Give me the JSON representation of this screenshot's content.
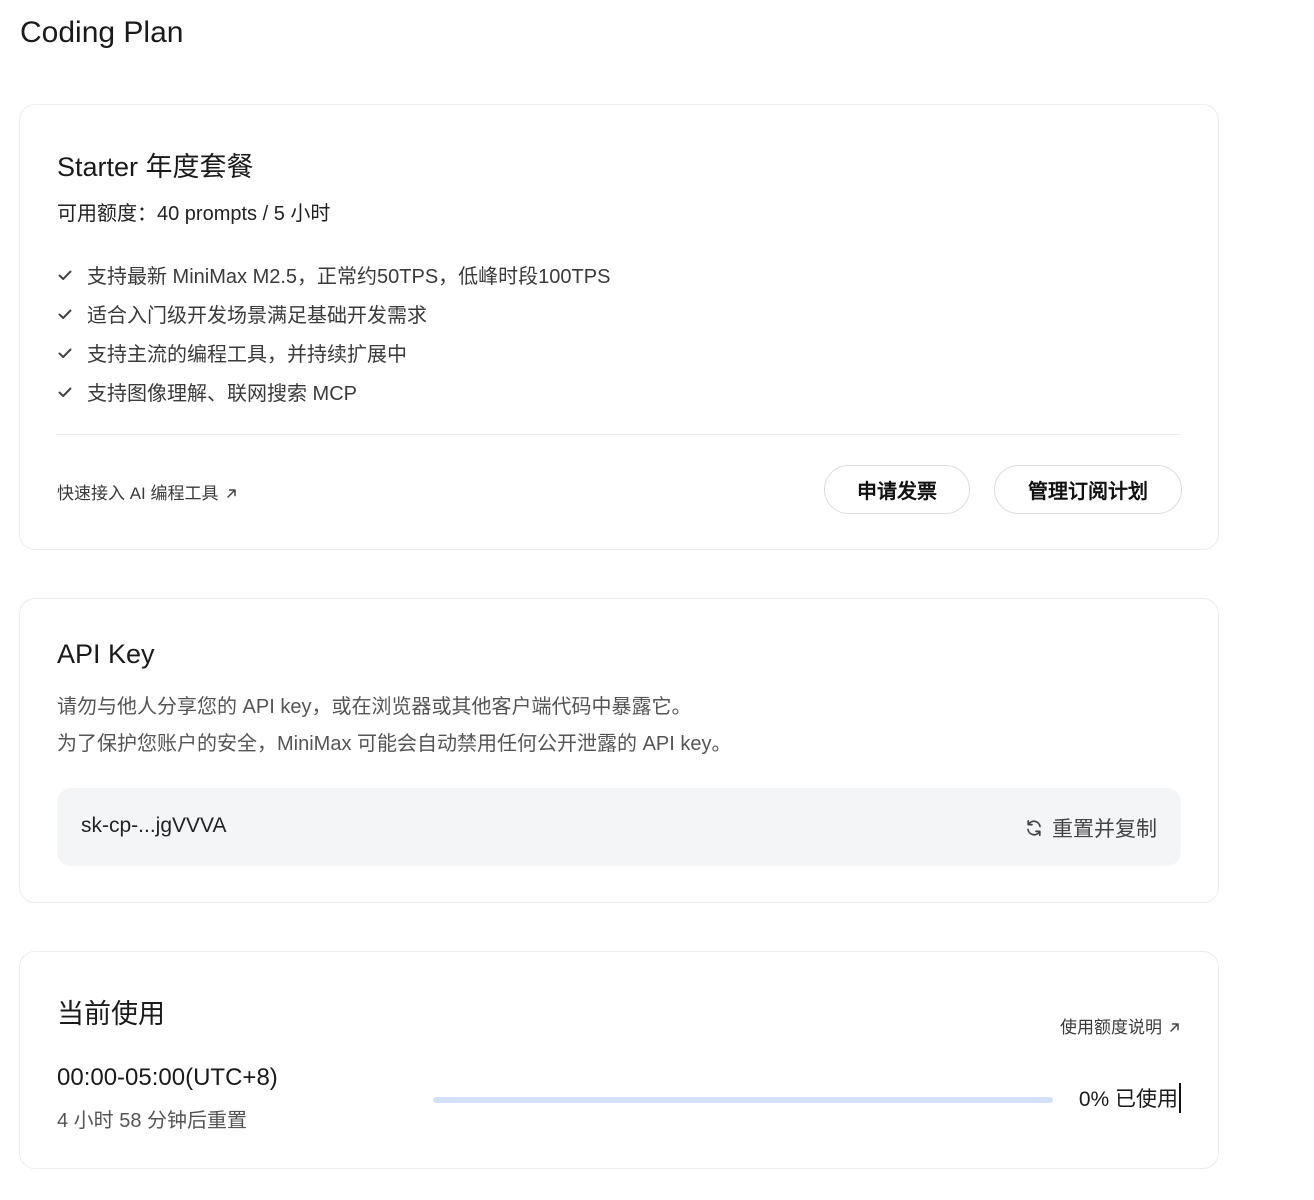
{
  "page": {
    "title": "Coding Plan"
  },
  "plan": {
    "name": "Starter  年度套餐",
    "quota": "可用额度：40 prompts / 5 小时",
    "features": [
      "支持最新 MiniMax M2.5，正常约50TPS，低峰时段100TPS",
      "适合入门级开发场景满足基础开发需求",
      "支持主流的编程工具，并持续扩展中",
      "支持图像理解、联网搜索 MCP"
    ],
    "quick_link": "快速接入 AI 编程工具",
    "invoice_button": "申请发票",
    "manage_button": "管理订阅计划"
  },
  "api_key": {
    "title": "API Key",
    "warning_line1": "请勿与他人分享您的 API key，或在浏览器或其他客户端代码中暴露它。",
    "warning_line2": "为了保护您账户的安全，MiniMax 可能会自动禁用任何公开泄露的 API key。",
    "value": "sk-cp-...jgVVVA",
    "reset_copy_label": "重置并复制"
  },
  "usage": {
    "title": "当前使用",
    "help_link": "使用额度说明",
    "window": "00:00-05:00(UTC+8)",
    "reset_in": "4 小时 58 分钟后重置",
    "percent_label": "0% 已使用",
    "progress_fraction": 0
  },
  "colors": {
    "accent": "#3b7cf5",
    "progress_track": "#d3e1fa",
    "key_box_bg": "#f4f5f7",
    "border": "#ececef"
  },
  "icons": {
    "check": "check-icon",
    "external_link": "arrow-up-right-icon",
    "refresh": "refresh-icon"
  }
}
